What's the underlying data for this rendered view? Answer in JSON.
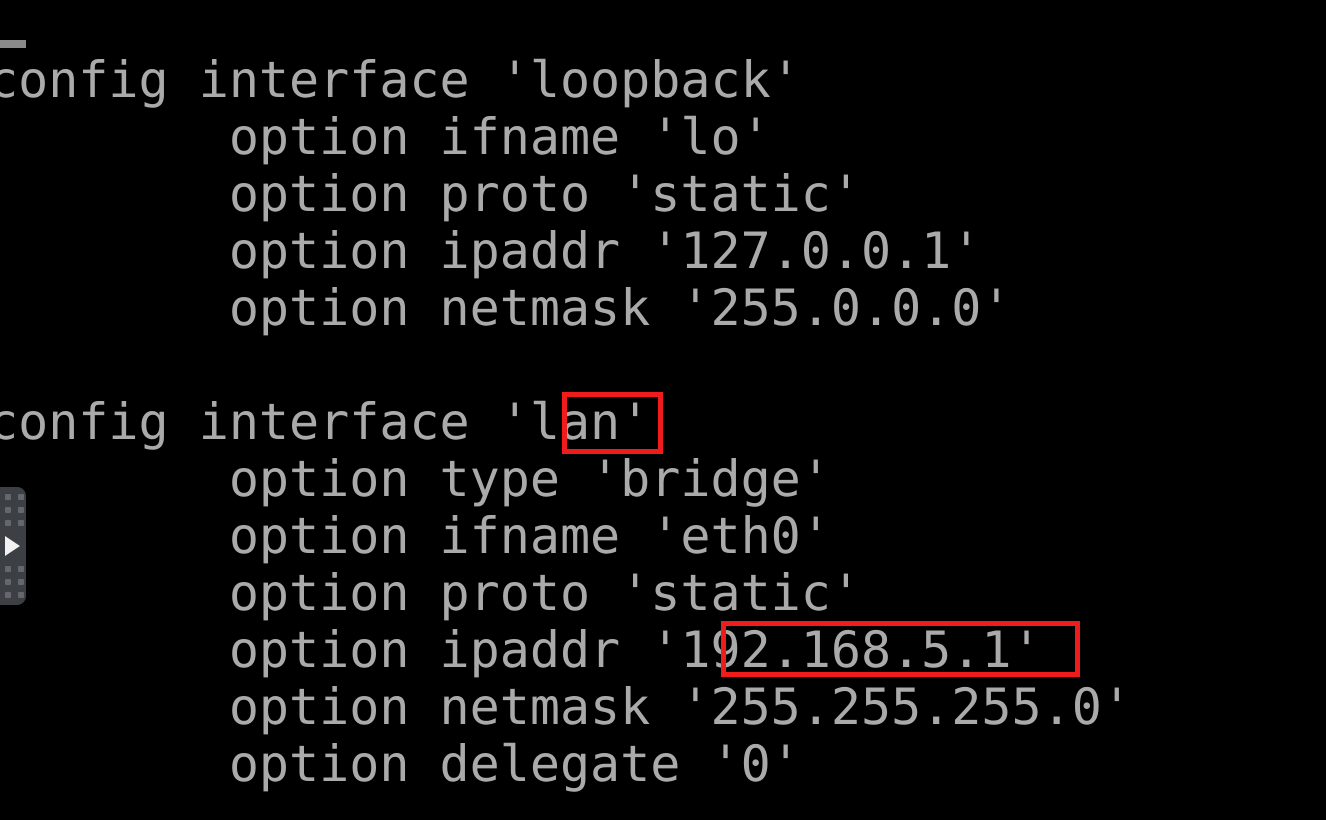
{
  "screen": {
    "background_color": "#000000",
    "text_color": "#aaaaaa",
    "accent_color": "#f01c1c"
  },
  "terminal": {
    "lines": [
      "config interface 'loopback'",
      "        option ifname 'lo'",
      "        option proto 'static'",
      "        option ipaddr '127.0.0.1'",
      "        option netmask '255.0.0.0'",
      "",
      "config interface 'lan'",
      "        option type 'bridge'",
      "        option ifname 'eth0'",
      "        option proto 'static'",
      "        option ipaddr '192.168.5.1'",
      "        option netmask '255.255.255.0'",
      "        option delegate '0'"
    ]
  },
  "annotations": {
    "lan_highlight": {
      "label": "lan",
      "color": "#f01c1c"
    },
    "ipaddr_highlight": {
      "label": "192.168.5.1",
      "color": "#f01c1c"
    }
  },
  "edge_widget": {
    "name": "drag-handle-play-widget",
    "play_label": "play"
  }
}
